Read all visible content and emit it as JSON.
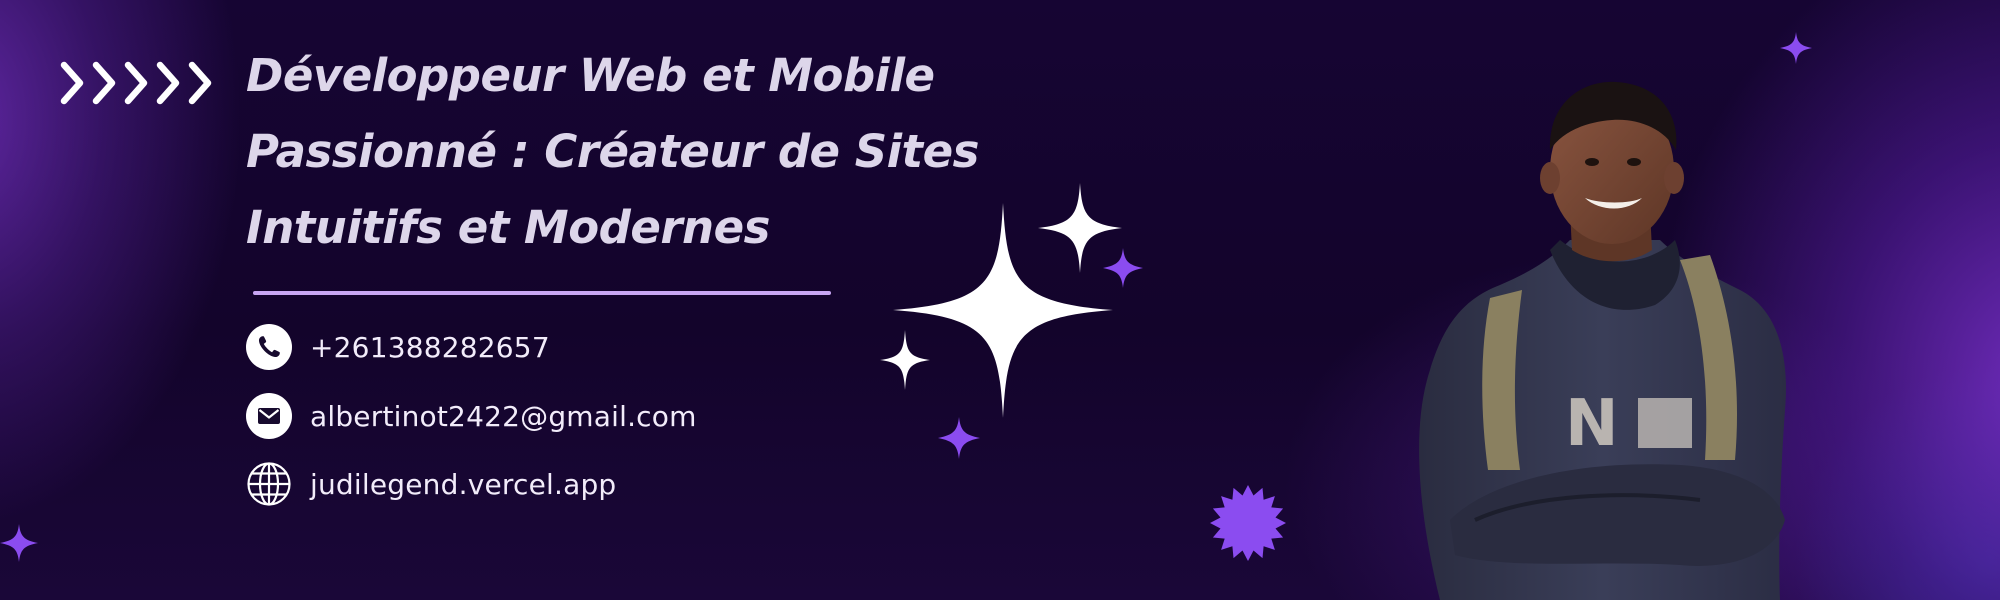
{
  "headline": {
    "line1": "Développeur Web et Mobile",
    "line2": "Passionné : Créateur de Sites",
    "line3": "Intuitifs et Modernes"
  },
  "contacts": {
    "phone": {
      "icon": "phone-icon",
      "text": "+261388282657"
    },
    "email": {
      "icon": "mail-icon",
      "text": "albertinot2422@gmail.com"
    },
    "website": {
      "icon": "globe-icon",
      "text": "judilegend.vercel.app"
    }
  },
  "portrait": {
    "shirt_text": "N"
  },
  "colors": {
    "accent_purple": "#8b4cf0",
    "sparkle_white": "#ffffff",
    "headline_text": "#ddd6ea",
    "divider": "#c8a6f4",
    "background": "#13042b"
  }
}
